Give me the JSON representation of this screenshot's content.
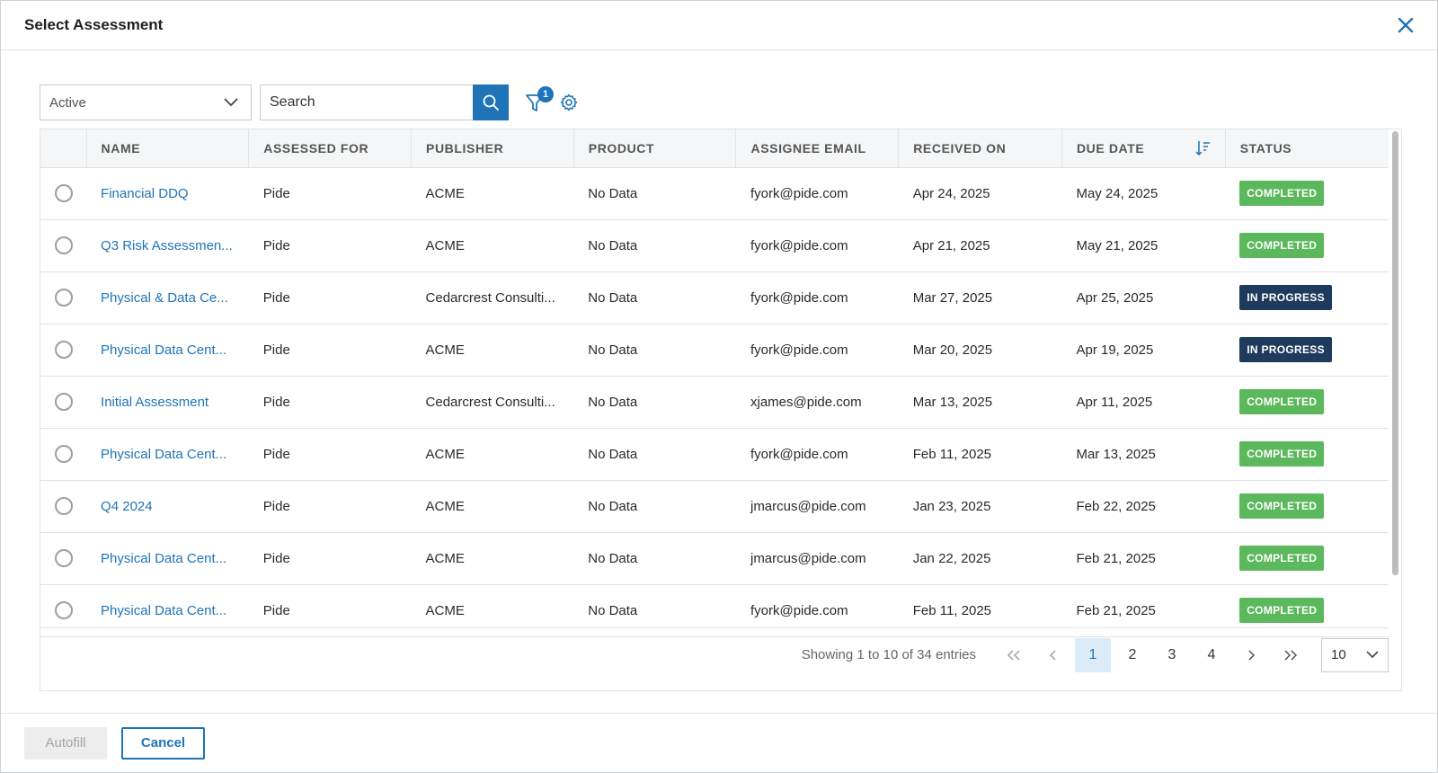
{
  "modal": {
    "title": "Select Assessment"
  },
  "toolbar": {
    "status_filter": "Active",
    "search_placeholder": "Search",
    "filter_badge_count": "1"
  },
  "table": {
    "columns": [
      "NAME",
      "ASSESSED FOR",
      "PUBLISHER",
      "PRODUCT",
      "ASSIGNEE EMAIL",
      "RECEIVED ON",
      "DUE DATE",
      "STATUS"
    ],
    "rows": [
      {
        "name": "Financial DDQ",
        "assessed_for": "Pide",
        "publisher": "ACME",
        "product": "No Data",
        "email": "fyork@pide.com",
        "received": "Apr 24, 2025",
        "due": "May 24, 2025",
        "status": "COMPLETED"
      },
      {
        "name": "Q3 Risk Assessmen...",
        "assessed_for": "Pide",
        "publisher": "ACME",
        "product": "No Data",
        "email": "fyork@pide.com",
        "received": "Apr 21, 2025",
        "due": "May 21, 2025",
        "status": "COMPLETED"
      },
      {
        "name": "Physical & Data Ce...",
        "assessed_for": "Pide",
        "publisher": "Cedarcrest Consulti...",
        "product": "No Data",
        "email": "fyork@pide.com",
        "received": "Mar 27, 2025",
        "due": "Apr 25, 2025",
        "status": "IN PROGRESS"
      },
      {
        "name": "Physical Data Cent...",
        "assessed_for": "Pide",
        "publisher": "ACME",
        "product": "No Data",
        "email": "fyork@pide.com",
        "received": "Mar 20, 2025",
        "due": "Apr 19, 2025",
        "status": "IN PROGRESS"
      },
      {
        "name": "Initial Assessment",
        "assessed_for": "Pide",
        "publisher": "Cedarcrest Consulti...",
        "product": "No Data",
        "email": "xjames@pide.com",
        "received": "Mar 13, 2025",
        "due": "Apr 11, 2025",
        "status": "COMPLETED"
      },
      {
        "name": "Physical Data Cent...",
        "assessed_for": "Pide",
        "publisher": "ACME",
        "product": "No Data",
        "email": "fyork@pide.com",
        "received": "Feb 11, 2025",
        "due": "Mar 13, 2025",
        "status": "COMPLETED"
      },
      {
        "name": "Q4 2024",
        "assessed_for": "Pide",
        "publisher": "ACME",
        "product": "No Data",
        "email": "jmarcus@pide.com",
        "received": "Jan 23, 2025",
        "due": "Feb 22, 2025",
        "status": "COMPLETED"
      },
      {
        "name": "Physical Data Cent...",
        "assessed_for": "Pide",
        "publisher": "ACME",
        "product": "No Data",
        "email": "jmarcus@pide.com",
        "received": "Jan 22, 2025",
        "due": "Feb 21, 2025",
        "status": "COMPLETED"
      },
      {
        "name": "Physical Data Cent...",
        "assessed_for": "Pide",
        "publisher": "ACME",
        "product": "No Data",
        "email": "fyork@pide.com",
        "received": "Feb 11, 2025",
        "due": "Feb 21, 2025",
        "status": "COMPLETED"
      }
    ]
  },
  "pager": {
    "info": "Showing 1 to 10 of 34 entries",
    "pages": [
      "1",
      "2",
      "3",
      "4"
    ],
    "active_page": "1",
    "page_size": "10"
  },
  "footer": {
    "autofill_label": "Autofill",
    "cancel_label": "Cancel"
  },
  "colors": {
    "accent": "#1f74b8",
    "completed": "#5cb85c",
    "in_progress": "#1e3a5c"
  }
}
